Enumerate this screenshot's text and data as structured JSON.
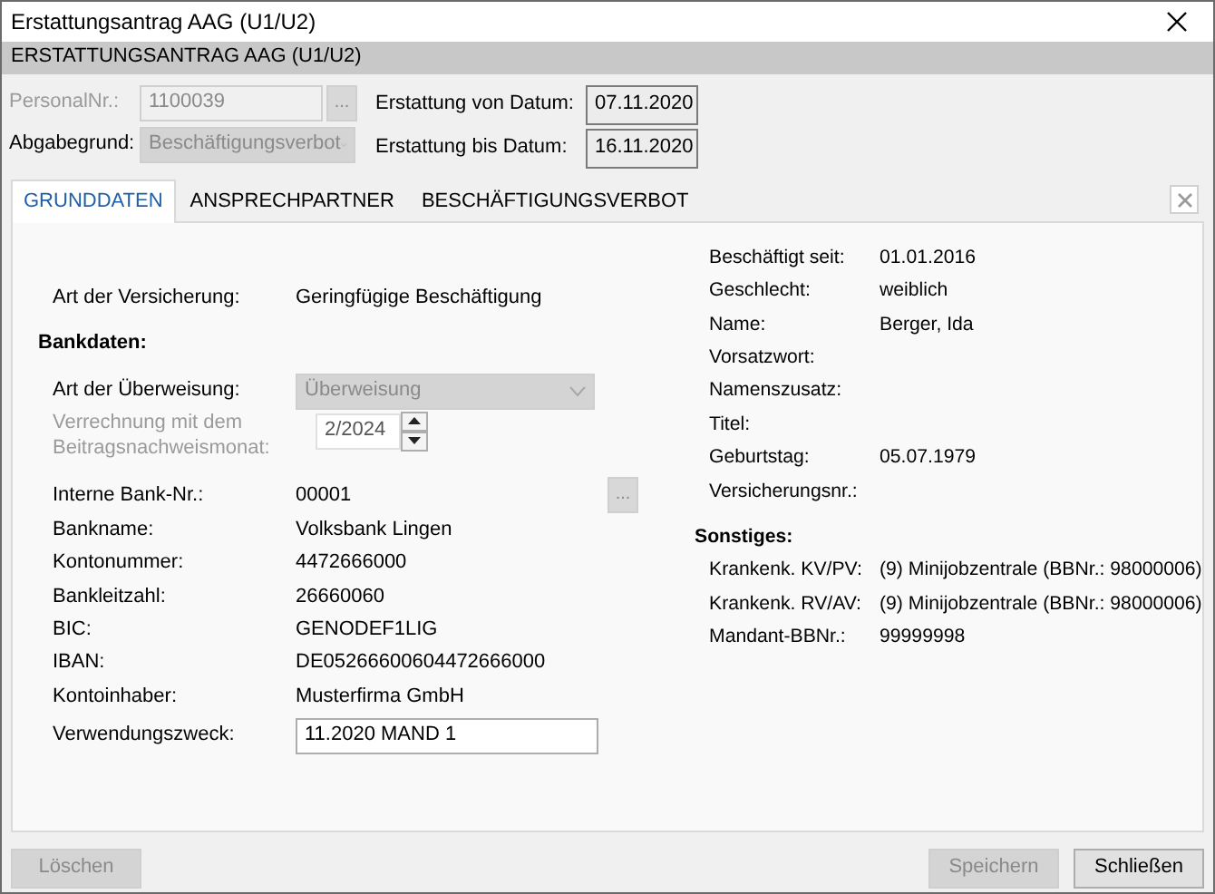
{
  "window": {
    "title": "Erstattungsantrag AAG (U1/U2)"
  },
  "header": "ERSTATTUNGSANTRAG AAG (U1/U2)",
  "top_left": [
    {
      "kind": "lookup",
      "label": "PersonalNr.:",
      "value": "1100039",
      "button": "...",
      "disabled": true
    },
    {
      "kind": "select",
      "label": "Abgabegrund:",
      "value": "Beschäftigungsverbot",
      "disabled": true
    }
  ],
  "top_right": [
    {
      "label": "Erstattung von Datum:",
      "value": "07.11.2020"
    },
    {
      "label": "Erstattung bis Datum:",
      "value": "16.11.2020"
    }
  ],
  "tabs": [
    {
      "label": "GRUNDDATEN",
      "selected": true
    },
    {
      "label": "ANSPRECHPARTNER",
      "selected": false
    },
    {
      "label": "BESCHÄFTIGUNGSVERBOT",
      "selected": false
    }
  ],
  "left_rows": [
    {
      "kind": "text",
      "label": "Art der Versicherung:",
      "value": "Geringfügige Beschäftigung"
    },
    {
      "kind": "heading",
      "label": "Bankdaten:"
    },
    {
      "kind": "select",
      "label": "Art der Überweisung:",
      "value": "Überweisung",
      "disabled": true
    },
    {
      "kind": "spinner",
      "label": "Verrechnung mit dem Beitragsnachweismonat:",
      "value": "2/2024",
      "disabled": true
    },
    {
      "kind": "lookup",
      "label": "Interne Bank-Nr.:",
      "value": "00001",
      "button": "...",
      "disabled": true
    },
    {
      "kind": "text",
      "label": "Bankname:",
      "value": "Volksbank Lingen"
    },
    {
      "kind": "text",
      "label": "Kontonummer:",
      "value": "4472666000"
    },
    {
      "kind": "text",
      "label": "Bankleitzahl:",
      "value": "26660060"
    },
    {
      "kind": "text",
      "label": "BIC:",
      "value": "GENODEF1LIG"
    },
    {
      "kind": "text",
      "label": "IBAN:",
      "value": "DE05266600604472666000"
    },
    {
      "kind": "text",
      "label": "Kontoinhaber:",
      "value": "Musterfirma GmbH"
    },
    {
      "kind": "input",
      "label": "Verwendungszweck:",
      "value": "11.2020 MAND 1",
      "disabled": false
    }
  ],
  "right_rows": [
    {
      "kind": "text",
      "label": "Beschäftigt seit:",
      "value": "01.01.2016"
    },
    {
      "kind": "text",
      "label": "Geschlecht:",
      "value": "weiblich"
    },
    {
      "kind": "text",
      "label": "Name:",
      "value": "Berger, Ida"
    },
    {
      "kind": "text",
      "label": "Vorsatzwort:"
    },
    {
      "kind": "text",
      "label": "Namenszusatz:"
    },
    {
      "kind": "text",
      "label": "Titel:"
    },
    {
      "kind": "text",
      "label": "Geburtstag:",
      "value": "05.07.1979"
    },
    {
      "kind": "text",
      "label": "Versicherungsnr.:"
    },
    {
      "kind": "heading",
      "label": "Sonstiges:"
    },
    {
      "kind": "text",
      "label": "Krankenk. KV/PV:",
      "value": "(9) Minijobzentrale (BBNr.: 98000006)"
    },
    {
      "kind": "text",
      "label": "Krankenk. RV/AV:",
      "value": "(9) Minijobzentrale (BBNr.: 98000006)"
    },
    {
      "kind": "text",
      "label": "Mandant-BBNr.:",
      "value": "99999998"
    }
  ],
  "buttons": [
    {
      "label": "Löschen",
      "disabled": true
    },
    {
      "label": "Speichern",
      "disabled": true
    },
    {
      "label": "Schließen",
      "disabled": false
    }
  ]
}
